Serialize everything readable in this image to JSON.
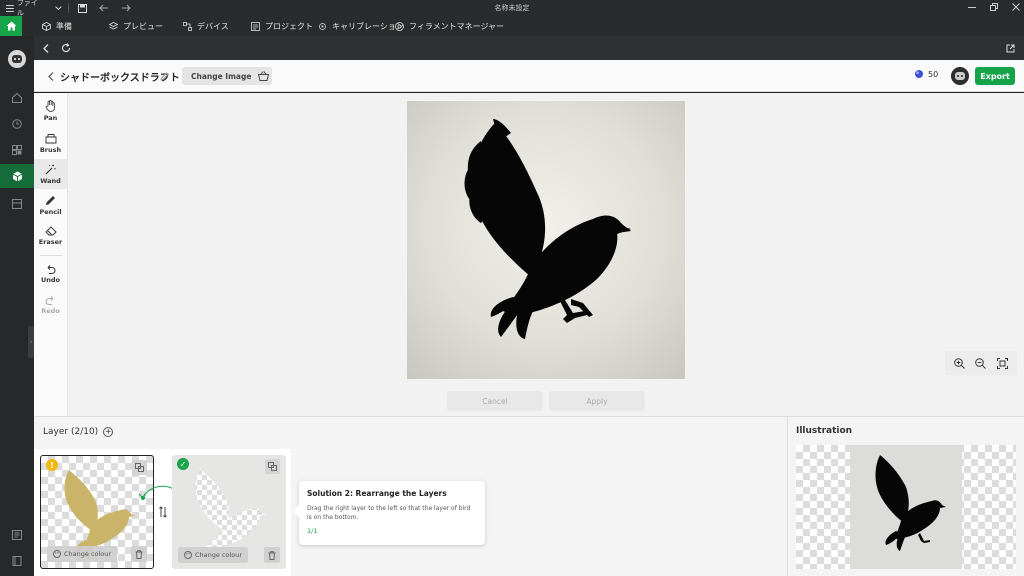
{
  "titlebar": {
    "menu_label": "ファイル",
    "window_title": "名称未設定"
  },
  "navbar": {
    "tabs": [
      {
        "label": "準備",
        "icon": "cube-icon"
      },
      {
        "label": "プレビュー",
        "icon": "layers-icon"
      },
      {
        "label": "デバイス",
        "icon": "device-icon"
      },
      {
        "label": "プロジェクト",
        "icon": "project-icon"
      },
      {
        "label": "キャリブレーション",
        "icon": "calibration-icon"
      },
      {
        "label": "フィラメントマネージャー",
        "icon": "filament-icon"
      }
    ]
  },
  "editor": {
    "title": "シャドーボックスドラフト",
    "change_image_label": "Change Image",
    "credits": "50",
    "export_label": "Export"
  },
  "tools": [
    {
      "label": "Pan",
      "icon": "hand-icon"
    },
    {
      "label": "Brush",
      "icon": "brush-icon"
    },
    {
      "label": "Wand",
      "icon": "wand-icon"
    },
    {
      "label": "Pencil",
      "icon": "pencil-icon"
    },
    {
      "label": "Eraser",
      "icon": "eraser-icon"
    },
    {
      "label": "Undo",
      "icon": "undo-icon"
    },
    {
      "label": "Redo",
      "icon": "redo-icon"
    }
  ],
  "canvas": {
    "cancel_label": "Cancel",
    "apply_label": "Apply"
  },
  "layer_panel": {
    "title": "Layer (2/10)",
    "change_colour_label": "Change colour",
    "colors": {
      "layer1_fill": "#c9b46a",
      "layer2_fill": "#ffffff"
    }
  },
  "tooltip": {
    "title": "Solution 2: Rearrange the Layers",
    "body": "Drag the right layer to the left so that the layer of bird is on the bottom.",
    "step": "1/1"
  },
  "illustration": {
    "title": "Illustration"
  },
  "colors": {
    "accent": "#16a34a",
    "warning": "#f2b80c"
  }
}
